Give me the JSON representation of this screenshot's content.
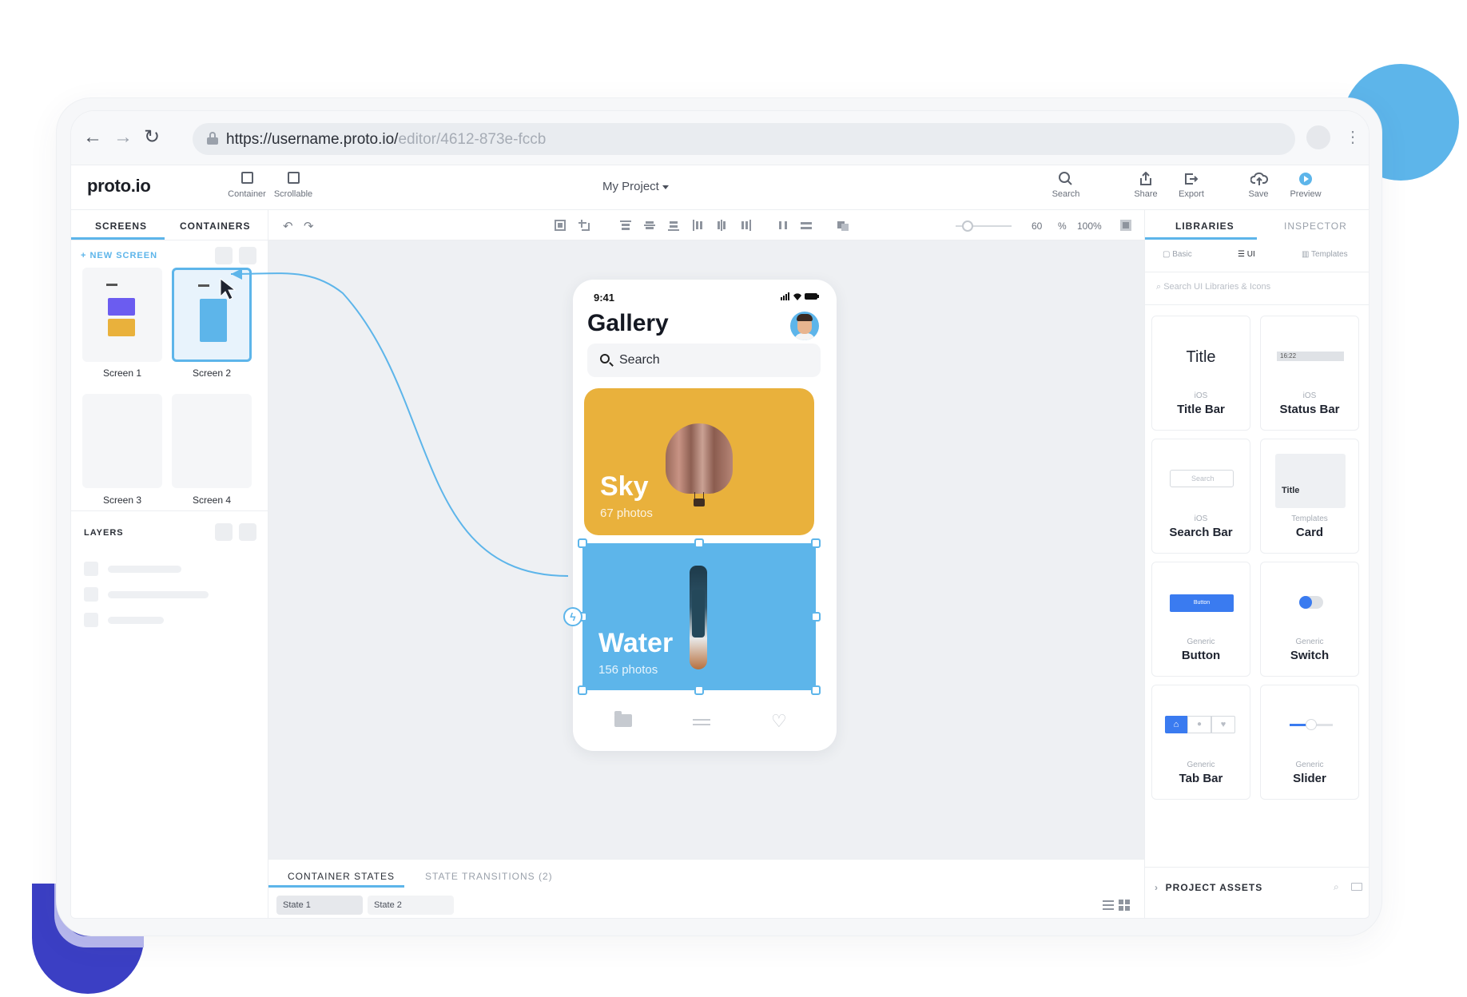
{
  "browser": {
    "url_main": "https://username.proto.io/",
    "url_dim": "editor/4612-873e-fccb"
  },
  "app": {
    "logo": "proto.io",
    "project_title": "My Project",
    "tools_left": [
      {
        "label": "Container",
        "icon": "container-icon"
      },
      {
        "label": "Scrollable",
        "icon": "scrollable-icon"
      }
    ],
    "tools_right": [
      {
        "label": "Search",
        "icon": "search-icon"
      },
      {
        "label": "Share",
        "icon": "share-icon"
      },
      {
        "label": "Export",
        "icon": "export-icon"
      },
      {
        "label": "Save",
        "icon": "cloud-upload-icon"
      },
      {
        "label": "Preview",
        "icon": "play-icon"
      }
    ]
  },
  "left_panel": {
    "tabs": [
      "SCREENS",
      "CONTAINERS"
    ],
    "new_screen": "+ NEW SCREEN",
    "screens": [
      "Screen 1",
      "Screen 2",
      "Screen 3",
      "Screen 4"
    ],
    "layers_title": "LAYERS"
  },
  "toolbar": {
    "zoom_value": "60",
    "zoom_unit": "%",
    "zoom_fit": "100%"
  },
  "phone": {
    "time": "9:41",
    "title": "Gallery",
    "search_placeholder": "Search",
    "cards": [
      {
        "title": "Sky",
        "subtitle": "67 photos",
        "color": "#e9b13c"
      },
      {
        "title": "Water",
        "subtitle": "156 photos",
        "color": "#5db5ea"
      }
    ]
  },
  "states": {
    "tabs": [
      "CONTAINER STATES",
      "STATE TRANSITIONS (2)"
    ],
    "pills": [
      "State 1",
      "State 2"
    ]
  },
  "right_panel": {
    "tabs": [
      "LIBRARIES",
      "INSPECTOR"
    ],
    "subtabs": [
      "Basic",
      "UI",
      "Templates"
    ],
    "search_placeholder": "Search UI Libraries & Icons",
    "items": [
      {
        "preview": "Title",
        "category": "iOS",
        "name": "Title Bar"
      },
      {
        "preview": "16:22",
        "category": "iOS",
        "name": "Status Bar"
      },
      {
        "preview": "Search",
        "category": "iOS",
        "name": "Search Bar"
      },
      {
        "preview": "Title",
        "category": "Templates",
        "name": "Card"
      },
      {
        "preview": "Button",
        "category": "Generic",
        "name": "Button"
      },
      {
        "preview": "",
        "category": "Generic",
        "name": "Switch"
      },
      {
        "preview": "",
        "category": "Generic",
        "name": "Tab Bar"
      },
      {
        "preview": "",
        "category": "Generic",
        "name": "Slider"
      }
    ],
    "project_assets": "PROJECT ASSETS"
  },
  "colors": {
    "accent": "#5db5ea",
    "indigo": "#3b3fc4",
    "sky_card": "#e9b13c"
  }
}
